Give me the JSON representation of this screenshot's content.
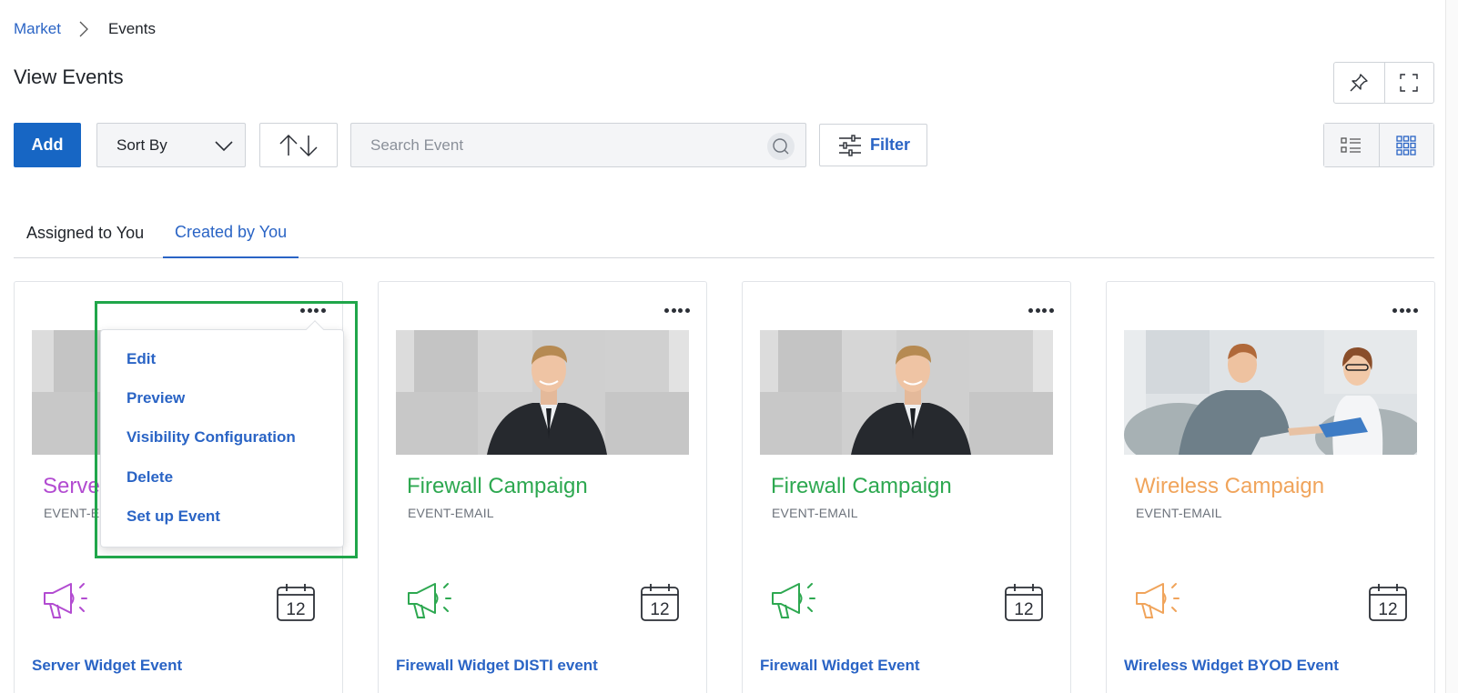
{
  "breadcrumb": {
    "parent": "Market",
    "current": "Events"
  },
  "page": {
    "title": "View Events"
  },
  "toolbar": {
    "add_label": "Add",
    "sort_label": "Sort By",
    "search_placeholder": "Search Event",
    "filter_label": "Filter"
  },
  "tabs": [
    {
      "label": "Assigned to You",
      "active": false
    },
    {
      "label": "Created by You",
      "active": true
    }
  ],
  "cards": [
    {
      "title": "Server Widget Event",
      "title_visible": "Serve",
      "type": "EVENT-E",
      "link": "Server Widget Event",
      "accent": "#b24bd1",
      "calendar_day": "12",
      "image": "placeholder"
    },
    {
      "title": "Firewall Campaign",
      "type": "EVENT-EMAIL",
      "link": "Firewall Widget DISTI event",
      "accent": "#2da850",
      "calendar_day": "12",
      "image": "man-suit"
    },
    {
      "title": "Firewall Campaign",
      "type": "EVENT-EMAIL",
      "link": "Firewall Widget Event",
      "accent": "#2da850",
      "calendar_day": "12",
      "image": "man-suit"
    },
    {
      "title": "Wireless Campaign",
      "type": "EVENT-EMAIL",
      "link": "Wireless Widget BYOD Event",
      "accent": "#f0a45b",
      "calendar_day": "12",
      "image": "handshake"
    }
  ],
  "context_menu": {
    "items": [
      "Edit",
      "Preview",
      "Visibility Configuration",
      "Delete",
      "Set up Event"
    ]
  },
  "colors": {
    "primary": "#1766c4",
    "link": "#2a64c5",
    "highlight": "#20a64a"
  }
}
